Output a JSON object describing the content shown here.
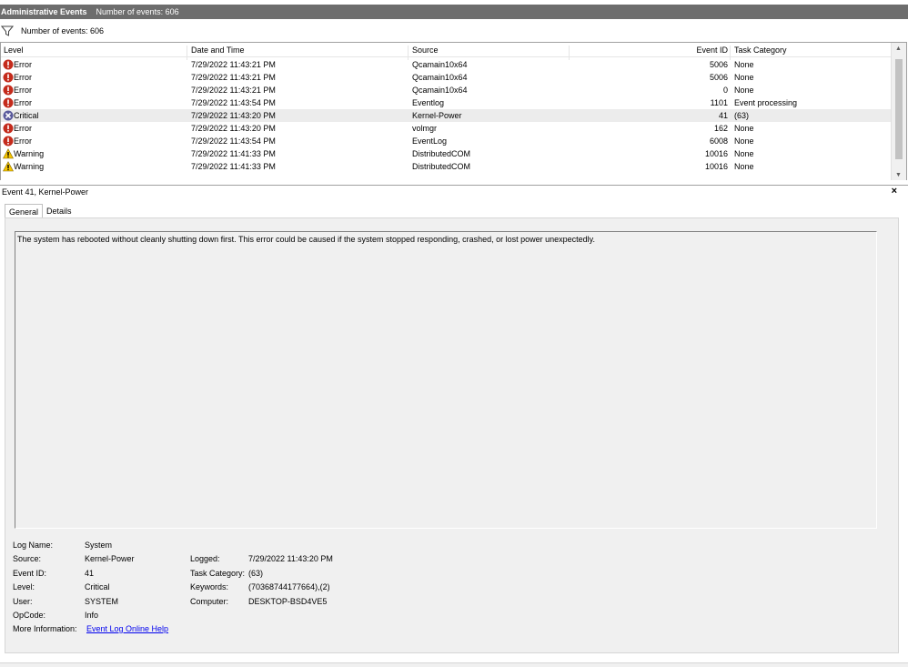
{
  "titlebar": {
    "title": "Administrative Events",
    "count": "Number of events: 606"
  },
  "filterbar": {
    "text": "Number of events: 606",
    "icon": "filter-icon"
  },
  "table": {
    "headers": {
      "level": "Level",
      "datetime": "Date and Time",
      "source": "Source",
      "event_id": "Event ID",
      "task_category": "Task Category"
    },
    "rows": [
      {
        "icon": "error-icon",
        "level": "Error",
        "datetime": "7/29/2022 11:43:21 PM",
        "source": "Qcamain10x64",
        "event_id": "5006",
        "task_category": "None"
      },
      {
        "icon": "error-icon",
        "level": "Error",
        "datetime": "7/29/2022 11:43:21 PM",
        "source": "Qcamain10x64",
        "event_id": "5006",
        "task_category": "None"
      },
      {
        "icon": "error-icon",
        "level": "Error",
        "datetime": "7/29/2022 11:43:21 PM",
        "source": "Qcamain10x64",
        "event_id": "0",
        "task_category": "None"
      },
      {
        "icon": "error-icon",
        "level": "Error",
        "datetime": "7/29/2022 11:43:54 PM",
        "source": "Eventlog",
        "event_id": "1101",
        "task_category": "Event processing"
      },
      {
        "icon": "critical-icon",
        "level": "Critical",
        "datetime": "7/29/2022 11:43:20 PM",
        "source": "Kernel-Power",
        "event_id": "41",
        "task_category": "(63)",
        "selected": true
      },
      {
        "icon": "error-icon",
        "level": "Error",
        "datetime": "7/29/2022 11:43:20 PM",
        "source": "volmgr",
        "event_id": "162",
        "task_category": "None"
      },
      {
        "icon": "error-icon",
        "level": "Error",
        "datetime": "7/29/2022 11:43:54 PM",
        "source": "EventLog",
        "event_id": "6008",
        "task_category": "None"
      },
      {
        "icon": "warning-icon",
        "level": "Warning",
        "datetime": "7/29/2022 11:41:33 PM",
        "source": "DistributedCOM",
        "event_id": "10016",
        "task_category": "None"
      },
      {
        "icon": "warning-icon",
        "level": "Warning",
        "datetime": "7/29/2022 11:41:33 PM",
        "source": "DistributedCOM",
        "event_id": "10016",
        "task_category": "None"
      }
    ]
  },
  "detail": {
    "title": "Event 41, Kernel-Power",
    "close": "×",
    "tabs": [
      "General",
      "Details"
    ],
    "message": "The system has rebooted without cleanly shutting down first. This error could be caused if the system stopped responding, crashed, or lost power unexpectedly.",
    "props": {
      "log_name_label": "Log Name:",
      "log_name": "System",
      "source_label": "Source:",
      "source": "Kernel-Power",
      "logged_label": "Logged:",
      "logged": "7/29/2022 11:43:20 PM",
      "event_id_label": "Event ID:",
      "event_id": "41",
      "task_category_label": "Task Category:",
      "task_category": "(63)",
      "level_label": "Level:",
      "level": "Critical",
      "keywords_label": "Keywords:",
      "keywords": "(70368744177664),(2)",
      "user_label": "User:",
      "user": "SYSTEM",
      "computer_label": "Computer:",
      "computer": "DESKTOP-BSD4VE5",
      "opcode_label": "OpCode:",
      "opcode": "Info",
      "more_info_label": "More Information:",
      "more_info_link": "Event Log Online Help"
    }
  },
  "colors": {
    "titlebar_bg": "#6d6d6d",
    "error": "#c42b1c",
    "critical": "#5a5a9c",
    "warning": "#f5c400",
    "link": "#0000ee"
  }
}
